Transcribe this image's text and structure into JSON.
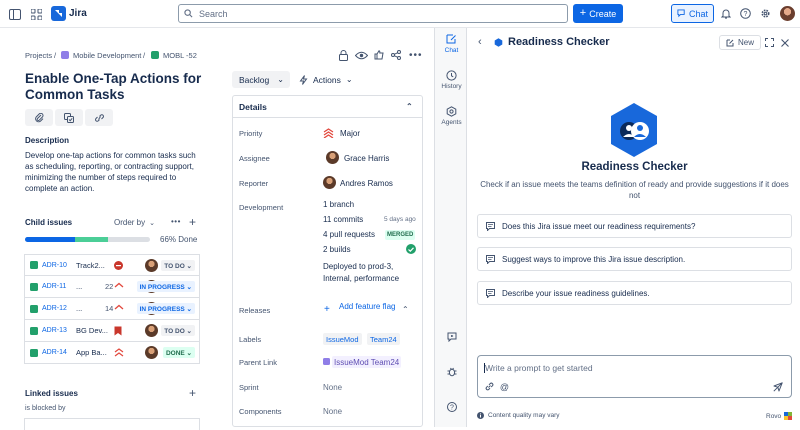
{
  "topbar": {
    "app_name": "Jira",
    "search_placeholder": "Search",
    "create_label": "Create",
    "chat_label": "Chat"
  },
  "breadcrumb": {
    "projects": "Projects",
    "project": "Mobile Development",
    "issue_key": "MOBL -52"
  },
  "issue": {
    "title": "Enable One-Tap Actions for Common Tasks",
    "description_heading": "Description",
    "description": "Develop one-tap actions for common tasks such as scheduling, reporting, or contracting support, minimizing the number of steps required to complete an action."
  },
  "child_issues": {
    "heading": "Child issues",
    "order_by": "Order by",
    "progress_label": "66% Done",
    "progress": {
      "done": 0.4,
      "in_progress": 0.26
    },
    "rows": [
      {
        "key": "ADR-10",
        "summary": "Track2...",
        "count": "",
        "status": "TO DO",
        "status_type": "todo"
      },
      {
        "key": "ADR-11",
        "summary": "...",
        "count": "22",
        "status": "IN PROGRESS",
        "status_type": "progress"
      },
      {
        "key": "ADR-12",
        "summary": "...",
        "count": "14",
        "status": "IN PROGRESS",
        "status_type": "progress"
      },
      {
        "key": "ADR-13",
        "summary": "BG Dev...",
        "count": "",
        "status": "TO DO",
        "status_type": "todo"
      },
      {
        "key": "ADR-14",
        "summary": "App Ba...",
        "count": "",
        "status": "DONE",
        "status_type": "done"
      }
    ]
  },
  "linked_issues": {
    "heading": "Linked issues",
    "relation": "is blocked by"
  },
  "status_controls": {
    "backlog": "Backlog",
    "actions": "Actions"
  },
  "details": {
    "heading": "Details",
    "priority_label": "Priority",
    "priority": "Major",
    "assignee_label": "Assignee",
    "assignee": "Grace Harris",
    "reporter_label": "Reporter",
    "reporter": "Andres Ramos",
    "development_label": "Development",
    "dev": {
      "branch": "1  branch",
      "commits": "11  commits",
      "commits_time": "5 days ago",
      "pull_requests": "4  pull requests",
      "pr_status": "MERGED",
      "builds": "2  builds",
      "deployed": "Deployed to prod-3, Internal, performance"
    },
    "releases_label": "Releases",
    "releases_action": "Add feature flag",
    "labels_label": "Labels",
    "labels": [
      "IssueMod",
      "Team24"
    ],
    "parent_label": "Parent Link",
    "parent": "IssueMod Team24",
    "sprint_label": "Sprint",
    "sprint": "None",
    "components_label": "Components",
    "components": "None"
  },
  "sidebar": {
    "chat": "Chat",
    "history": "History",
    "agents": "Agents"
  },
  "rovo": {
    "panel_title": "Readiness Checker",
    "new_label": "New",
    "agent_name": "Readiness Checker",
    "agent_description": "Check if an issue meets the teams definition of ready and provide suggestions if it does not",
    "suggestions": [
      "Does this Jira issue meet our readiness requirements?",
      "Suggest ways to improve this Jira issue description.",
      "Describe your issue readiness guidelines."
    ],
    "prompt_placeholder": "Write a prompt to get started",
    "footer_note": "Content quality may vary",
    "footer_brand": "Rovo"
  },
  "colors": {
    "brand": "#0c66e4",
    "done": "#22a06b",
    "progress": "#1d7afc",
    "agent": "#1868db"
  }
}
